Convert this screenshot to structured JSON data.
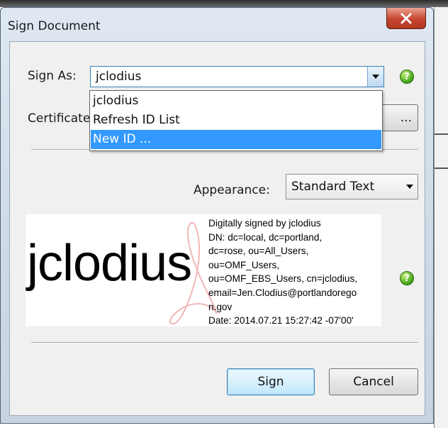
{
  "window": {
    "title": "Sign Document"
  },
  "sign_as": {
    "label": "Sign As:",
    "value": "jclodius"
  },
  "certificate": {
    "label": "Certificate",
    "button_label": "..."
  },
  "dropdown": {
    "items": [
      "jclodius",
      "Refresh ID List",
      "New ID ..."
    ],
    "highlighted_index": 2
  },
  "appearance": {
    "label": "Appearance:",
    "value": "Standard Text"
  },
  "signature_preview": {
    "name": "jclodius",
    "details": [
      "Digitally signed by jclodius",
      "DN: dc=local, dc=portland,",
      "dc=rose, ou=All_Users,",
      "ou=OMF_Users,",
      "ou=OMF_EBS_Users, cn=jclodius,",
      "email=Jen.Clodius@portlandoregо",
      "n.gov",
      "Date: 2014.07.21 15:27:42 -07'00'"
    ]
  },
  "buttons": {
    "sign": "Sign",
    "cancel": "Cancel"
  },
  "icons": {
    "help": "help-icon",
    "help_glyph": "?",
    "close": "close-icon"
  },
  "colors": {
    "selection": "#3399ff",
    "help_green": "#3fa316",
    "close_red": "#c7452f"
  }
}
